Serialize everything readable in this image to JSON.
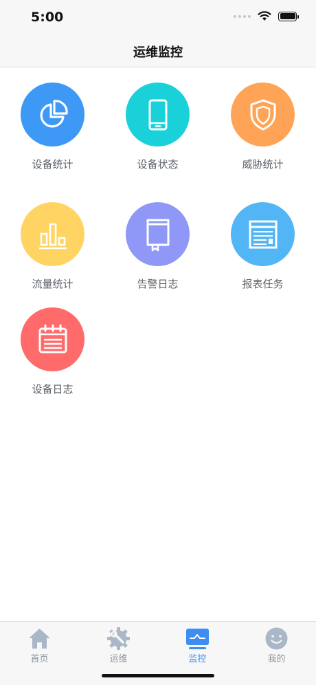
{
  "status_bar": {
    "time": "5:00"
  },
  "nav": {
    "title": "运维监控"
  },
  "tiles": [
    {
      "label": "设备统计",
      "icon": "pie-chart-icon",
      "color": "#3d99f5"
    },
    {
      "label": "设备状态",
      "icon": "phone-icon",
      "color": "#1bd1d9"
    },
    {
      "label": "威胁统计",
      "icon": "shield-icon",
      "color": "#ffa456"
    },
    {
      "label": "流量统计",
      "icon": "bar-chart-icon",
      "color": "#ffd462"
    },
    {
      "label": "告警日志",
      "icon": "book-icon",
      "color": "#8f98f7"
    },
    {
      "label": "报表任务",
      "icon": "table-icon",
      "color": "#52b5f5"
    },
    {
      "label": "设备日志",
      "icon": "calendar-icon",
      "color": "#ff6b6b"
    }
  ],
  "tabs": [
    {
      "label": "首页",
      "icon": "home-icon",
      "active": false
    },
    {
      "label": "运维",
      "icon": "gear-wrench-icon",
      "active": false
    },
    {
      "label": "监控",
      "icon": "monitor-icon",
      "active": true
    },
    {
      "label": "我的",
      "icon": "smiley-icon",
      "active": false
    }
  ],
  "colors": {
    "tab_active": "#3d8ef0",
    "tab_inactive": "#8e959d",
    "icon_gray": "#a9b7c6"
  }
}
